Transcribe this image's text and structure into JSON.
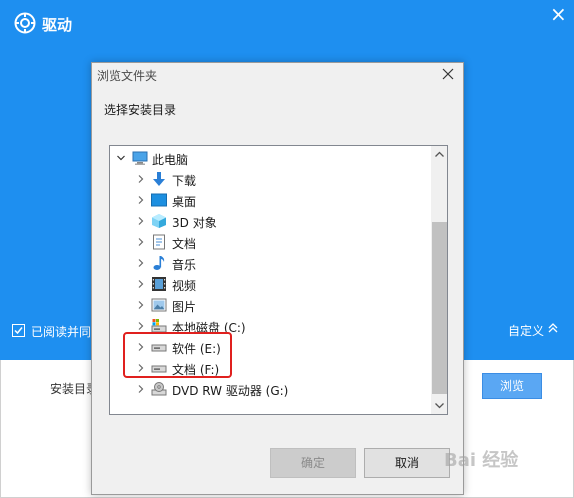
{
  "installer": {
    "title": "驱动",
    "agree_text": "已阅读并同意",
    "custom_label": "自定义",
    "install_dir_label": "安装目录",
    "browse_label": "浏览"
  },
  "dialog": {
    "title": "浏览文件夹",
    "prompt": "选择安装目录",
    "ok_label": "确定",
    "cancel_label": "取消"
  },
  "tree": [
    {
      "label": "此电脑",
      "icon": "computer-icon",
      "expanded": true
    },
    {
      "label": "下载",
      "icon": "downloads-icon"
    },
    {
      "label": "桌面",
      "icon": "desktop-icon"
    },
    {
      "label": "3D 对象",
      "icon": "3d-objects-icon"
    },
    {
      "label": "文档",
      "icon": "documents-icon"
    },
    {
      "label": "音乐",
      "icon": "music-icon"
    },
    {
      "label": "视频",
      "icon": "videos-icon"
    },
    {
      "label": "图片",
      "icon": "pictures-icon"
    },
    {
      "label": "本地磁盘 (C:)",
      "icon": "system-drive-icon"
    },
    {
      "label": "软件 (E:)",
      "icon": "drive-icon"
    },
    {
      "label": "文档 (F:)",
      "icon": "drive-icon"
    },
    {
      "label": "DVD RW 驱动器 (G:)",
      "icon": "dvd-drive-icon"
    }
  ],
  "watermark": "Bai 经验",
  "colors": {
    "installer_blue": "#1e8ff0",
    "highlight_red": "#e0201e",
    "browse_button": "#5aa7f3"
  }
}
